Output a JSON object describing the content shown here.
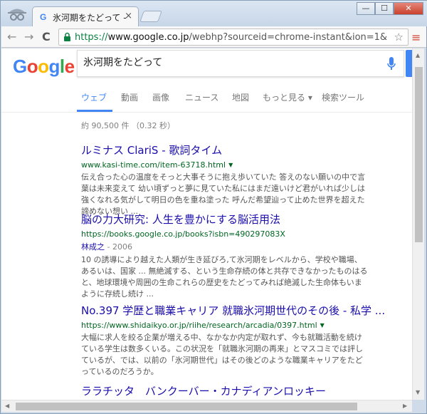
{
  "browser": {
    "tab_title": "氷河期をたどって -",
    "tab_close": "×",
    "favicon": "G",
    "url_scheme": "https://",
    "url_host": "www.google.co.jp",
    "url_rest": "/webhp?sourceid=chrome-instant&ion=1&espv",
    "window_buttons": [
      "—",
      "☐",
      "✕"
    ]
  },
  "icons": {
    "back": "←",
    "forward": "→",
    "reload": "C",
    "lock": "🔒",
    "star": "☆",
    "menu": "≡"
  },
  "logo": [
    "G",
    "o",
    "o",
    "g",
    "l",
    "e"
  ],
  "search": {
    "query": "氷河期をたどって"
  },
  "search_tabs": [
    {
      "label": "ウェブ",
      "active": true
    },
    {
      "label": "動画"
    },
    {
      "label": "画像"
    },
    {
      "label": "ニュース"
    },
    {
      "label": "地図"
    },
    {
      "label": "もっと見る ▾"
    },
    {
      "label": "検索ツール"
    }
  ],
  "stats": "約 90,500 件 （0.32 秒）",
  "results": [
    {
      "title": "ルミナス ClariS - 歌詞タイム",
      "url": "www.kasi-time.com/item-63718.html",
      "snippet": "伝え合った心の温度をそっと大事そうに抱え歩いていた 答えのない願いの中で言葉は未来変えて 幼い頃ずっと夢に見ていた私にはまだ遠いけど君がいれば少しは強くなれる気がして明日の色を重ね塗った 呼んだ希望辿って止めた世界を超えた諦めない想い ..."
    },
    {
      "title": "脳の力大研究: 人生を豊かにする脳活用法",
      "url": "https://books.google.co.jp/books?isbn=490297083X",
      "author": "林成之",
      "year": " - 2006",
      "snippet": "10 の誘導により越えた人類が生き延びろ,て氷河期をレベルから、学校や職場、あるいは、国家 ... 無絶滅する、という生命存続の体と共存できなかったものはると、地球環境や周囲の生命これらの歴史をたどってみれば絶滅した生命体もいまように存続し続け ..."
    },
    {
      "title": "No.397 学歴と職業キャリア 就職氷河期世代のその後 - 私学 ...",
      "url": "https://www.shidaikyo.or.jp/riihe/research/arcadia/0397.html",
      "snippet": "大幅に求人を絞る企業が増える中、なかなか内定が取れず、今も就職活動を続けている学生は数多くいる。この状況を「就職氷河期の再来」とマスコミでは評しているが、では、以前の「氷河期世代」はその後どのような職業キャリアをたどっているのだろうか。"
    },
    {
      "title": "ララチッタ　バンクーバー・カナディアンロッキー"
    }
  ],
  "colors": {
    "link": "#1a0dab",
    "url_green": "#006621",
    "accent": "#4285f4"
  }
}
